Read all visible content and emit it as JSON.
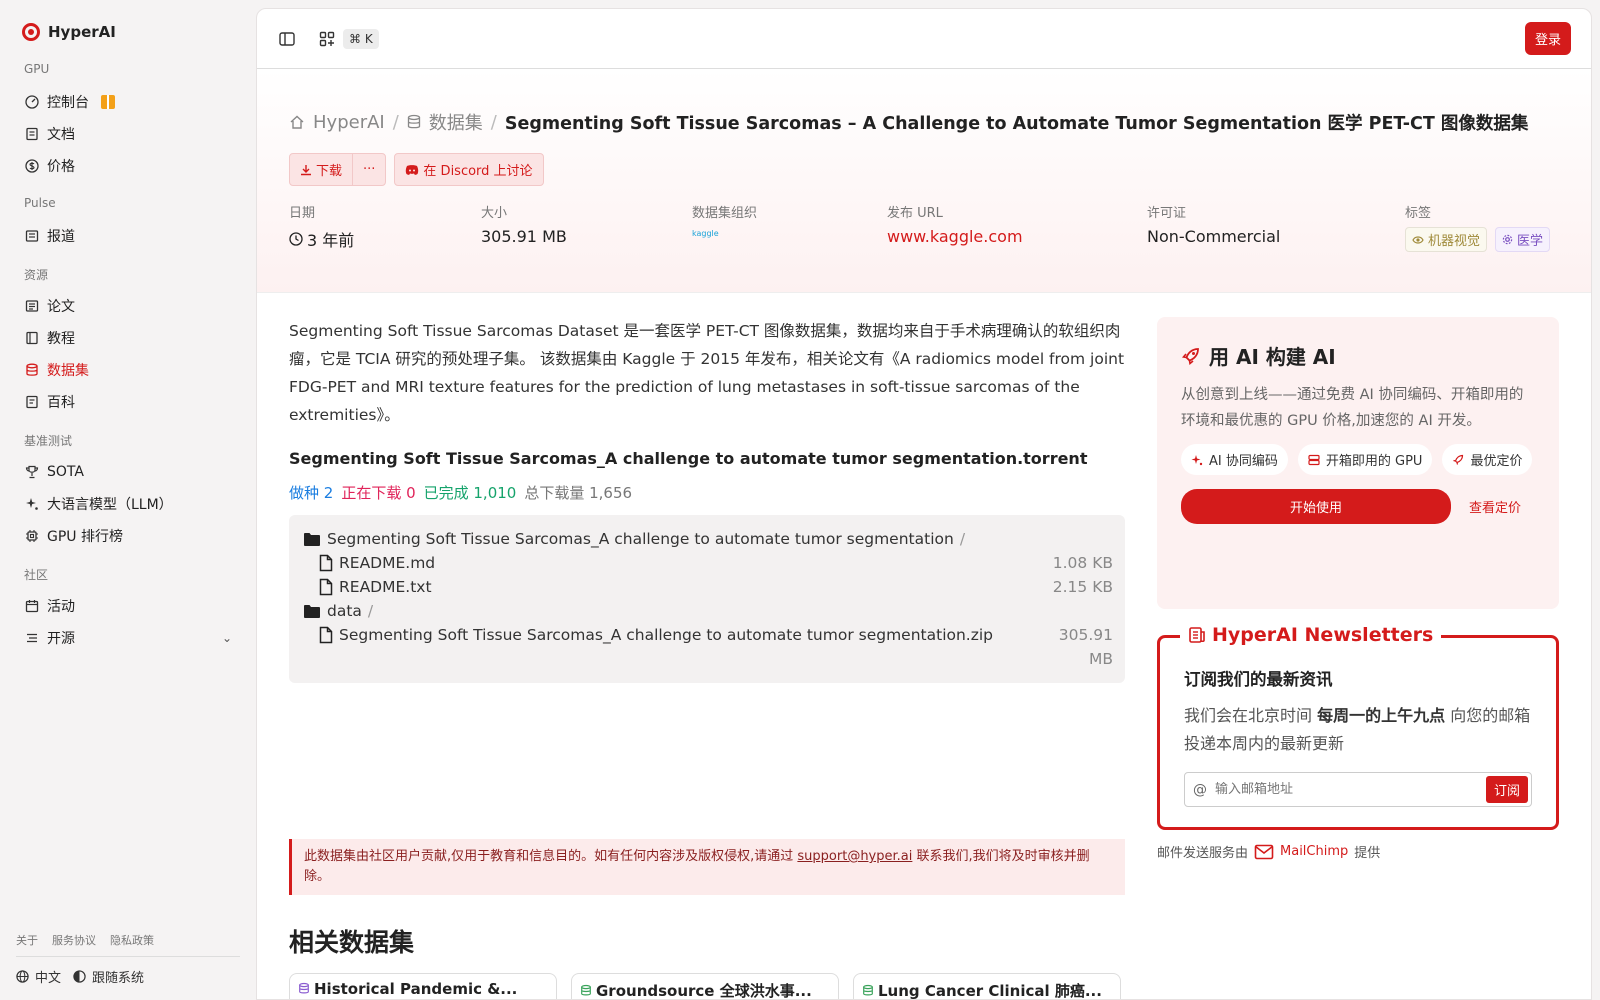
{
  "brand": {
    "name": "HyperAI"
  },
  "sidebar": {
    "sections": [
      {
        "title": "GPU",
        "items": [
          {
            "label": "控制台",
            "icon": "dashboard-icon",
            "gift": true
          },
          {
            "label": "文档",
            "icon": "document-icon"
          },
          {
            "label": "价格",
            "icon": "dollar-icon"
          }
        ]
      },
      {
        "title": "Pulse",
        "items": [
          {
            "label": "报道",
            "icon": "news-icon"
          }
        ]
      },
      {
        "title": "资源",
        "items": [
          {
            "label": "论文",
            "icon": "paper-icon"
          },
          {
            "label": "教程",
            "icon": "tutorial-icon"
          },
          {
            "label": "数据集",
            "icon": "database-icon",
            "active": true
          },
          {
            "label": "百科",
            "icon": "wiki-icon"
          }
        ]
      },
      {
        "title": "基准测试",
        "items": [
          {
            "label": "SOTA",
            "icon": "trophy-icon"
          },
          {
            "label": "大语言模型（LLM）",
            "icon": "sparkle-icon"
          },
          {
            "label": "GPU 排行榜",
            "icon": "chip-icon"
          }
        ]
      },
      {
        "title": "社区",
        "items": [
          {
            "label": "活动",
            "icon": "calendar-icon"
          },
          {
            "label": "开源",
            "icon": "list-icon",
            "expandable": true
          }
        ]
      }
    ],
    "footer_links": [
      "关于",
      "服务协议",
      "隐私政策"
    ],
    "language": "中文",
    "theme": "跟随系统"
  },
  "topbar": {
    "shortcut": "⌘ K",
    "login": "登录"
  },
  "breadcrumb": {
    "home": "HyperAI",
    "section": "数据集",
    "current": "Segmenting Soft Tissue Sarcomas – A Challenge to Automate Tumor Segmentation 医学 PET-CT 图像数据集"
  },
  "actions": {
    "download": "下载",
    "more": "···",
    "discord": "在 Discord 上讨论"
  },
  "meta": {
    "date_label": "日期",
    "date_value": "3 年前",
    "size_label": "大小",
    "size_value": "305.91 MB",
    "org_label": "数据集组织",
    "org_value": "kaggle",
    "url_label": "发布 URL",
    "url_value": "www.kaggle.com",
    "license_label": "许可证",
    "license_value": "Non-Commercial",
    "tags_label": "标签",
    "tags": [
      "机器视觉",
      "医学"
    ]
  },
  "description": "Segmenting Soft Tissue Sarcomas Dataset 是一套医学 PET-CT 图像数据集，数据均来自于手术病理确认的软组织肉瘤，它是 TCIA 研究的预处理子集。 该数据集由 Kaggle 于 2015 年发布，相关论文有《A radiomics model from joint FDG-PET and MRI texture features for the prediction of lung metastases in soft-tissue sarcomas of the extremities》。",
  "torrent": {
    "title": "Segmenting Soft Tissue Sarcomas_A challenge to automate tumor segmentation.torrent",
    "seed": "做种 2",
    "downloading": "正在下载 0",
    "completed": "已完成 1,010",
    "total": "总下载量 1,656",
    "files": [
      {
        "name": "Segmenting Soft Tissue Sarcomas_A challenge to automate tumor segmentation",
        "folder": true,
        "size": ""
      },
      {
        "name": "README.md",
        "folder": false,
        "size": "1.08 KB",
        "indent": true
      },
      {
        "name": "README.txt",
        "folder": false,
        "size": "2.15 KB",
        "indent": true
      },
      {
        "name": "data",
        "folder": true,
        "size": ""
      },
      {
        "name": "Segmenting Soft Tissue Sarcomas_A challenge to automate tumor segmentation.zip",
        "folder": false,
        "size": "305.91 MB",
        "indent": true
      }
    ]
  },
  "notice": {
    "before": "此数据集由社区用户贡献,仅用于教育和信息目的。如有任何内容涉及版权侵权,请通过 ",
    "email": "support@hyper.ai",
    "after": " 联系我们,我们将及时审核并删除。"
  },
  "related": {
    "title": "相关数据集",
    "cards": [
      "Historical Pandemic &...",
      "Groundsource 全球洪水事...",
      "Lung Cancer Clinical 肺癌..."
    ]
  },
  "promo": {
    "title": "用 AI 构建 AI",
    "text": "从创意到上线——通过免费 AI 协同编码、开箱即用的环境和最优惠的 GPU 价格,加速您的 AI 开发。",
    "chips": [
      "AI 协同编码",
      "开箱即用的 GPU",
      "最优定价"
    ],
    "start": "开始使用",
    "pricing": "查看定价"
  },
  "newsletter": {
    "title": "HyperAI Newsletters",
    "heading": "订阅我们的最新资讯",
    "text_before": "我们会在北京时间 ",
    "text_bold": "每周一的上午九点",
    "text_after": " 向您的邮箱投递本周内的最新更新",
    "placeholder": "输入邮箱地址",
    "subscribe": "订阅",
    "mailer_before": "邮件发送服务由",
    "mailer_name": "MailChimp",
    "mailer_after": "提供"
  },
  "colors": {
    "accent": "#d41b1b",
    "seed": "#1a7de0",
    "downloading": "#e0245a",
    "completed": "#15a36b"
  }
}
